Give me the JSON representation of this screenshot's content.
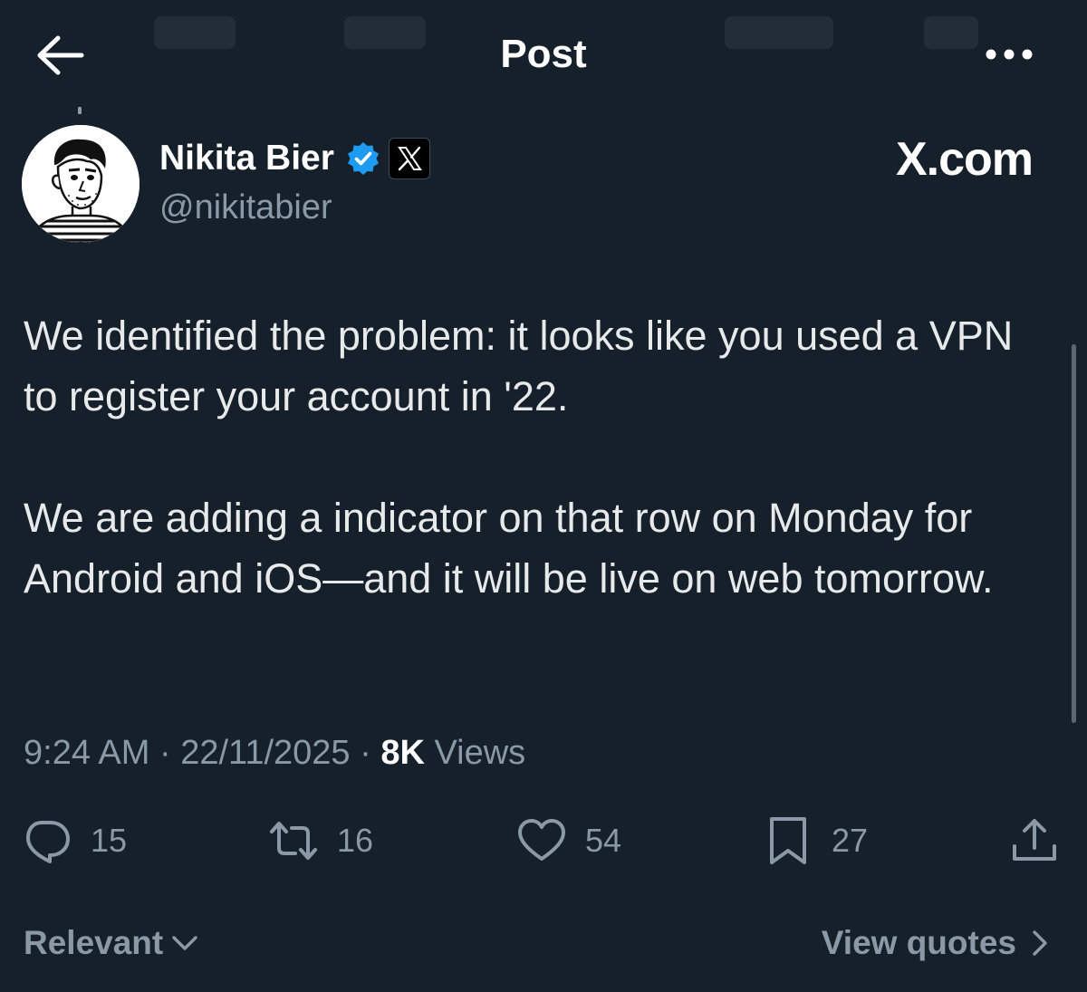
{
  "header": {
    "title": "Post"
  },
  "author": {
    "name": "Nikita Bier",
    "handle": "@nikitabier",
    "verified": true,
    "affiliation_badge": "x-logo-icon"
  },
  "watermark": "X.com",
  "post": {
    "paragraphs": [
      "We identified the problem: it looks like you used a VPN to register your account in '22.",
      "We are adding a indicator on that row on Monday for Android and iOS—and it will be live on web tomorrow."
    ],
    "time": "9:24 AM",
    "date": "22/11/2025",
    "views_count": "8K",
    "views_label": "Views",
    "separator": "·"
  },
  "actions": {
    "replies": "15",
    "reposts": "16",
    "likes": "54",
    "bookmarks": "27"
  },
  "footer": {
    "sort_label": "Relevant",
    "view_quotes_label": "View quotes"
  },
  "colors": {
    "background": "#15202b",
    "text_primary": "#e7e9ea",
    "text_secondary": "#8b98a5",
    "verified_blue": "#1d9bf0"
  }
}
